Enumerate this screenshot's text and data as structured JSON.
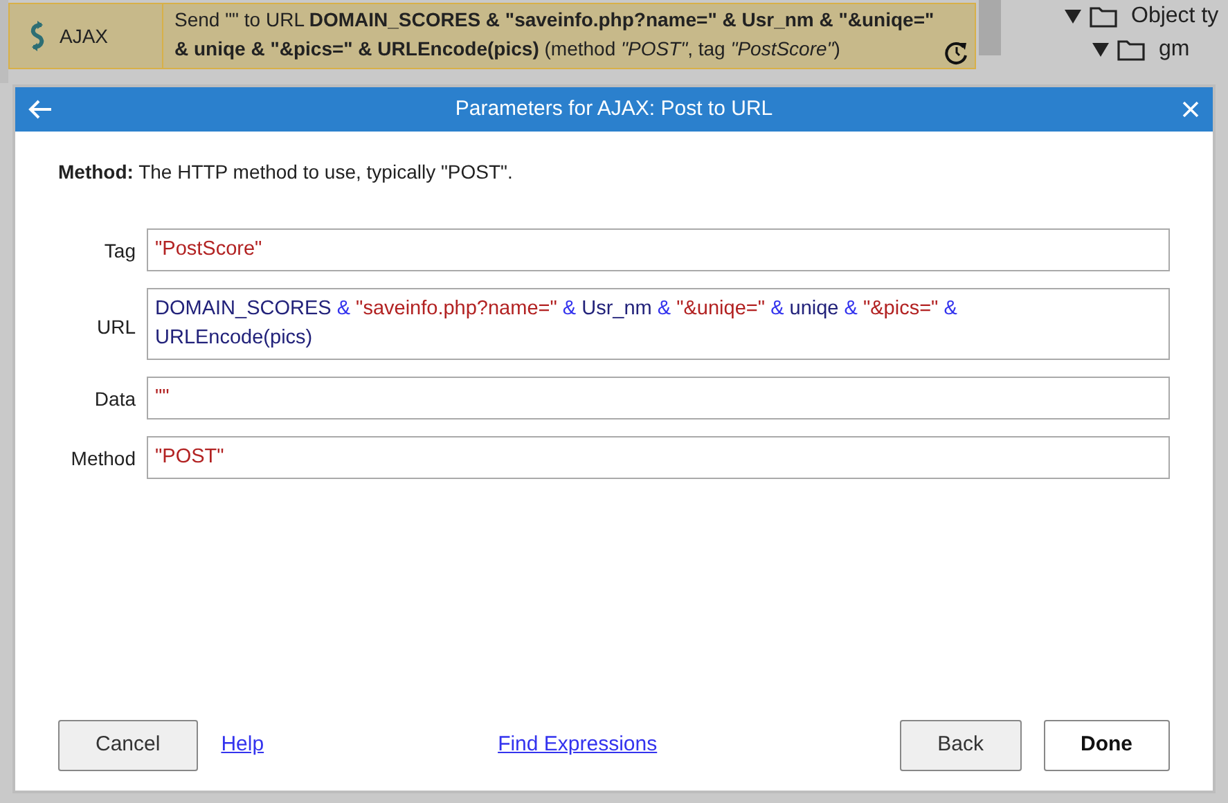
{
  "event_row": {
    "object": "AJAX",
    "action": "Send \"\" to URL **DOMAIN_SCORES & \"saveinfo.php?name=\" & Usr_nm & \"&uniqe=\" & uniqe & \"&pics=\" & URLEncode(pics)** (method *\"POST\"*, tag *\"PostScore\"*)"
  },
  "tree": [
    {
      "label": "Object ty",
      "expanded": true
    },
    {
      "label": "gm",
      "expanded": true
    }
  ],
  "dialog": {
    "title": "Parameters for AJAX: Post to URL",
    "description": "**Method:** The HTTP method to use, typically \"POST\".",
    "fields": [
      {
        "label": "Tag",
        "tokens": [
          {
            "kind": "string",
            "text": "\"PostScore\""
          }
        ]
      },
      {
        "label": "URL",
        "tokens": [
          {
            "kind": "name",
            "text": "DOMAIN_SCORES"
          },
          {
            "kind": "operator",
            "text": "&"
          },
          {
            "kind": "string",
            "text": "\"saveinfo.php?name=\""
          },
          {
            "kind": "operator",
            "text": "&"
          },
          {
            "kind": "name",
            "text": "Usr_nm"
          },
          {
            "kind": "operator",
            "text": "&"
          },
          {
            "kind": "string",
            "text": "\"&uniqe=\""
          },
          {
            "kind": "operator",
            "text": "&"
          },
          {
            "kind": "name",
            "text": "uniqe"
          },
          {
            "kind": "operator",
            "text": "&"
          },
          {
            "kind": "string",
            "text": "\"&pics=\""
          },
          {
            "kind": "operator",
            "text": "&"
          },
          {
            "kind": "name",
            "text": "URLEncode(pics)"
          }
        ]
      },
      {
        "label": "Data",
        "tokens": [
          {
            "kind": "string",
            "text": "\"\""
          }
        ]
      },
      {
        "label": "Method",
        "tokens": [
          {
            "kind": "string",
            "text": "\"POST\""
          }
        ]
      }
    ],
    "footer": [
      {
        "kind": "button",
        "label": "Cancel",
        "default": false
      },
      {
        "kind": "link",
        "label": "Help"
      },
      {
        "kind": "link",
        "label": "Find Expressions"
      },
      {
        "kind": "button",
        "label": "Back",
        "default": false
      },
      {
        "kind": "button",
        "label": "Done",
        "default": true
      }
    ]
  }
}
